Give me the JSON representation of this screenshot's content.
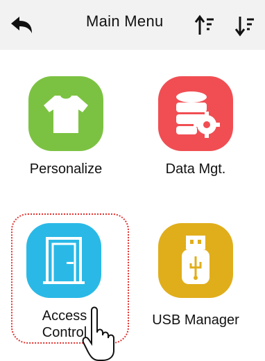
{
  "header": {
    "title": "Main Menu",
    "back_icon": "back-arrow-icon",
    "sort_asc_icon": "sort-ascending-icon",
    "sort_desc_icon": "sort-descending-icon"
  },
  "menu": [
    {
      "label": "Personalize",
      "icon": "tshirt-icon",
      "color": "#7cc242"
    },
    {
      "label": "Data Mgt.",
      "icon": "database-gear-icon",
      "color": "#f04e53"
    },
    {
      "label_line1": "Access",
      "label_line2": "Control",
      "icon": "door-icon",
      "color": "#2ab9e6",
      "focused": true
    },
    {
      "label": "USB Manager",
      "icon": "usb-drive-icon",
      "color": "#e0ae1b"
    }
  ],
  "colors": {
    "header_bg": "#f2f2f2",
    "focus_ring": "#e0322f"
  },
  "cursor_icon": "hand-pointer-icon"
}
